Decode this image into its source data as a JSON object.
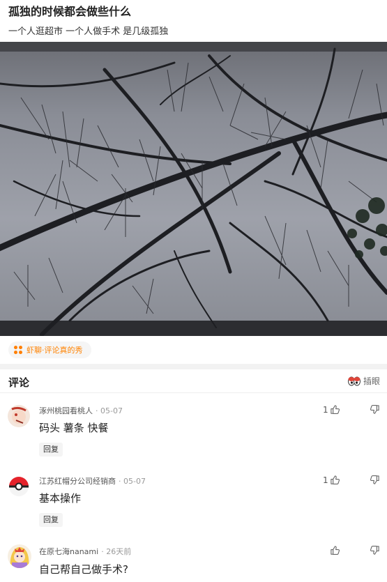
{
  "post": {
    "title": "孤独的时候都会做些什么",
    "subtitle": "一个人逛超市 一个人做手术 是几级孤独"
  },
  "tag": {
    "icon": "four-dots-icon",
    "label": "虾聊·评论真的秀",
    "color": "#ff8200"
  },
  "comments_section": {
    "title": "评论",
    "insert_eye_label": "插眼"
  },
  "comments": [
    {
      "user": "涿州桃园看桃人",
      "time": "· 05-07",
      "text": "码头 薯条 快餐",
      "reply_label": "回复",
      "likes": "1"
    },
    {
      "user": "江苏红帽分公司经销商",
      "time": "· 05-07",
      "text": "基本操作",
      "reply_label": "回复",
      "likes": "1"
    },
    {
      "user": "在原七海nanami",
      "time": "· 26天前",
      "text": "自己帮自己做手术?",
      "likes": ""
    }
  ]
}
